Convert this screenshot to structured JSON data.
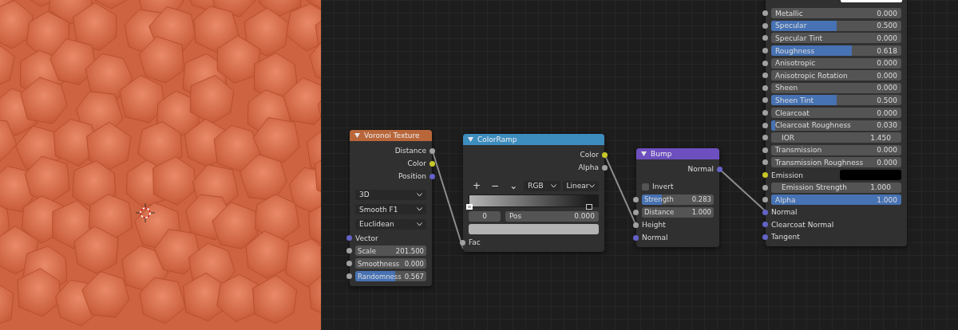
{
  "nodes": [
    {
      "title": "Voronoi Texture",
      "color": "#b8663a",
      "rows": [
        {
          "kind": "output",
          "label": "Distance",
          "color": "#a1a1a1"
        },
        {
          "kind": "output",
          "label": "Color",
          "color": "#c7c729"
        },
        {
          "kind": "output",
          "label": "Position",
          "color": "#6363c7"
        },
        {
          "kind": "dropdown",
          "label": "3D"
        },
        {
          "kind": "dropdown",
          "label": "Smooth F1"
        },
        {
          "kind": "dropdown",
          "label": "Euclidean"
        },
        {
          "kind": "input",
          "label": "Vector",
          "color": "#6363c7"
        },
        {
          "kind": "field",
          "label": "Scale",
          "value": "201.500",
          "color": "#a1a1a1"
        },
        {
          "kind": "field",
          "label": "Smoothness",
          "value": "0.000",
          "color": "#a1a1a1"
        },
        {
          "kind": "slider",
          "label": "Randomness",
          "value": "0.567",
          "level": 0.567,
          "color": "#a1a1a1"
        }
      ]
    },
    {
      "title": "ColorRamp",
      "color": "#3d8dbf",
      "rows": [
        {
          "kind": "output",
          "label": "Color",
          "color": "#c7c729"
        },
        {
          "kind": "output",
          "label": "Alpha",
          "color": "#a1a1a1"
        },
        {
          "kind": "ramp_tools",
          "buttons": [
            "+",
            "−",
            "⌄"
          ],
          "modes": [
            "RGB",
            "Linear"
          ]
        },
        {
          "kind": "ramp",
          "stops": [
            {
              "level": 0,
              "color": "#b4b4b4",
              "selected": true
            },
            {
              "level": 0.93,
              "color": "#1c1c1c",
              "selected": false
            }
          ]
        },
        {
          "kind": "ramp_stop",
          "index": "0",
          "label": "Pos",
          "value": "0.000"
        },
        {
          "kind": "ramp_color"
        },
        {
          "kind": "input",
          "label": "Fac",
          "color": "#a1a1a1"
        }
      ]
    },
    {
      "title": "Bump",
      "color": "#6e4fbf",
      "rows": [
        {
          "kind": "output",
          "label": "Normal",
          "color": "#6363c7"
        },
        {
          "kind": "checkbox",
          "label": "Invert",
          "checked": false
        },
        {
          "kind": "slider",
          "label": "Strength",
          "value": "0.283",
          "level": 0.283,
          "color": "#a1a1a1"
        },
        {
          "kind": "field",
          "label": "Distance",
          "value": "1.000",
          "color": "#a1a1a1"
        },
        {
          "kind": "input",
          "label": "Height",
          "color": "#a1a1a1"
        },
        {
          "kind": "input",
          "label": "Normal",
          "color": "#6363c7"
        }
      ]
    },
    {
      "rows": [
        {
          "kind": "slider",
          "label": "Metallic",
          "value": "0.000",
          "level": 0,
          "color": "#a1a1a1"
        },
        {
          "kind": "slider",
          "label": "Specular",
          "value": "0.500",
          "level": 0.5,
          "color": "#a1a1a1"
        },
        {
          "kind": "slider",
          "label": "Specular Tint",
          "value": "0.000",
          "level": 0,
          "color": "#a1a1a1"
        },
        {
          "kind": "slider",
          "label": "Roughness",
          "value": "0.618",
          "level": 0.618,
          "color": "#a1a1a1"
        },
        {
          "kind": "slider",
          "label": "Anisotropic",
          "value": "0.000",
          "level": 0,
          "color": "#a1a1a1"
        },
        {
          "kind": "slider",
          "label": "Anisotropic Rotation",
          "value": "0.000",
          "level": 0,
          "color": "#a1a1a1"
        },
        {
          "kind": "slider",
          "label": "Sheen",
          "value": "0.000",
          "level": 0,
          "color": "#a1a1a1"
        },
        {
          "kind": "slider",
          "label": "Sheen Tint",
          "value": "0.500",
          "level": 0.5,
          "color": "#a1a1a1"
        },
        {
          "kind": "slider",
          "label": "Clearcoat",
          "value": "0.000",
          "level": 0,
          "color": "#a1a1a1"
        },
        {
          "kind": "slider",
          "label": "Clearcoat Roughness",
          "value": "0.030",
          "level": 0.03,
          "color": "#a1a1a1"
        },
        {
          "kind": "field",
          "label": "IOR",
          "value": "1.450",
          "color": "#a1a1a1"
        },
        {
          "kind": "slider",
          "label": "Transmission",
          "value": "0.000",
          "level": 0,
          "color": "#a1a1a1"
        },
        {
          "kind": "slider",
          "label": "Transmission Roughness",
          "value": "0.000",
          "level": 0,
          "color": "#a1a1a1"
        },
        {
          "kind": "color",
          "label": "Emission",
          "swatch": {
            "color": "#000000"
          },
          "color": "#c7c729"
        },
        {
          "kind": "field",
          "label": "Emission Strength",
          "value": "1.000",
          "color": "#a1a1a1"
        },
        {
          "kind": "slider",
          "label": "Alpha",
          "value": "1.000",
          "level": 1,
          "color": "#a1a1a1"
        },
        {
          "kind": "input",
          "label": "Normal",
          "color": "#6363c7"
        },
        {
          "kind": "input",
          "label": "Clearcoat Normal",
          "color": "#6363c7"
        },
        {
          "kind": "input",
          "label": "Tangent",
          "color": "#6363c7"
        }
      ]
    }
  ]
}
